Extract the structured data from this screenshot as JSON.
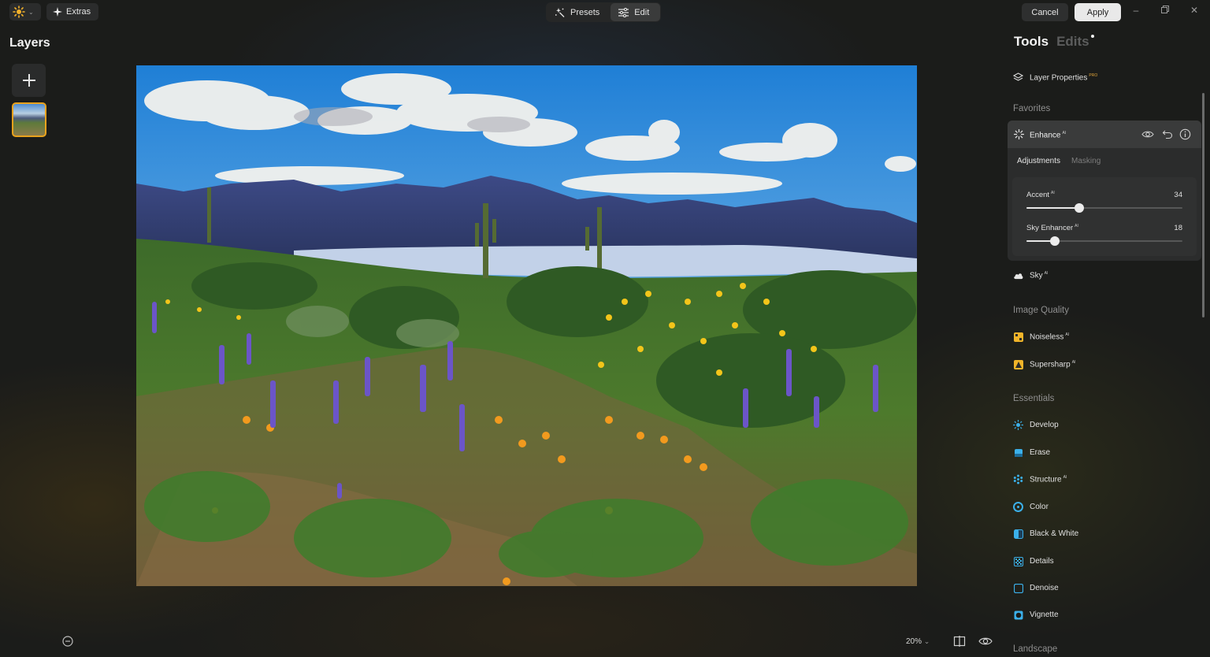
{
  "topbar": {
    "extras_label": "Extras",
    "presets_label": "Presets",
    "edit_label": "Edit",
    "cancel_label": "Cancel",
    "apply_label": "Apply",
    "minimize_icon": "minimize-icon",
    "restore_icon": "restore-icon",
    "close_icon": "close-icon"
  },
  "layers": {
    "title": "Layers",
    "add_icon": "plus-icon"
  },
  "canvas": {
    "zoom": "20%"
  },
  "right_panel": {
    "tab_tools": "Tools",
    "tab_edits": "Edits",
    "layer_properties": {
      "label": "Layer Properties",
      "badge": "PRO"
    },
    "favorites_label": "Favorites",
    "enhance": {
      "title": "Enhance",
      "badge": "AI",
      "tab_adjustments": "Adjustments",
      "tab_masking": "Masking",
      "sliders": [
        {
          "label": "Accent",
          "badge": "AI",
          "value": "34",
          "max": 100
        },
        {
          "label": "Sky Enhancer",
          "badge": "AI",
          "value": "18",
          "max": 100
        }
      ]
    },
    "sky": {
      "label": "Sky",
      "badge": "AI"
    },
    "image_quality_label": "Image Quality",
    "noiseless": {
      "label": "Noiseless",
      "badge": "AI"
    },
    "supersharp": {
      "label": "Supersharp",
      "badge": "AI"
    },
    "essentials_label": "Essentials",
    "essentials": [
      {
        "label": "Develop",
        "badge": ""
      },
      {
        "label": "Erase",
        "badge": ""
      },
      {
        "label": "Structure",
        "badge": "AI"
      },
      {
        "label": "Color",
        "badge": ""
      },
      {
        "label": "Black & White",
        "badge": ""
      },
      {
        "label": "Details",
        "badge": ""
      },
      {
        "label": "Denoise",
        "badge": ""
      },
      {
        "label": "Vignette",
        "badge": ""
      }
    ],
    "landscape_label": "Landscape"
  },
  "colors": {
    "accent": "#e8a21d",
    "develop_icon": "#3bb0ea",
    "apply_bg": "#e9e9e9"
  }
}
